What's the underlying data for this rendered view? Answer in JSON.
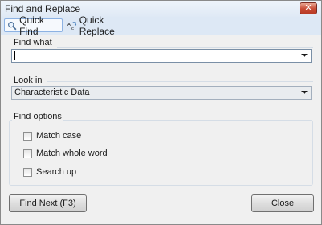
{
  "window": {
    "title": "Find and Replace"
  },
  "tabs": [
    {
      "label": "Quick Find",
      "icon": "magnifier-icon",
      "active": true
    },
    {
      "label": "Quick Replace",
      "icon": "replace-icon",
      "active": false
    }
  ],
  "find_what": {
    "label": "Find what",
    "value": ""
  },
  "look_in": {
    "label": "Look in",
    "value": "Characteristic Data"
  },
  "find_options": {
    "label": "Find options",
    "items": [
      {
        "label": "Match case",
        "checked": false
      },
      {
        "label": "Match whole word",
        "checked": false
      },
      {
        "label": "Search up",
        "checked": false
      }
    ]
  },
  "buttons": {
    "find_next": "Find Next (F3)",
    "close": "Close"
  },
  "colors": {
    "tab_highlight": "#dde8f5",
    "close_button": "#c84a34"
  }
}
